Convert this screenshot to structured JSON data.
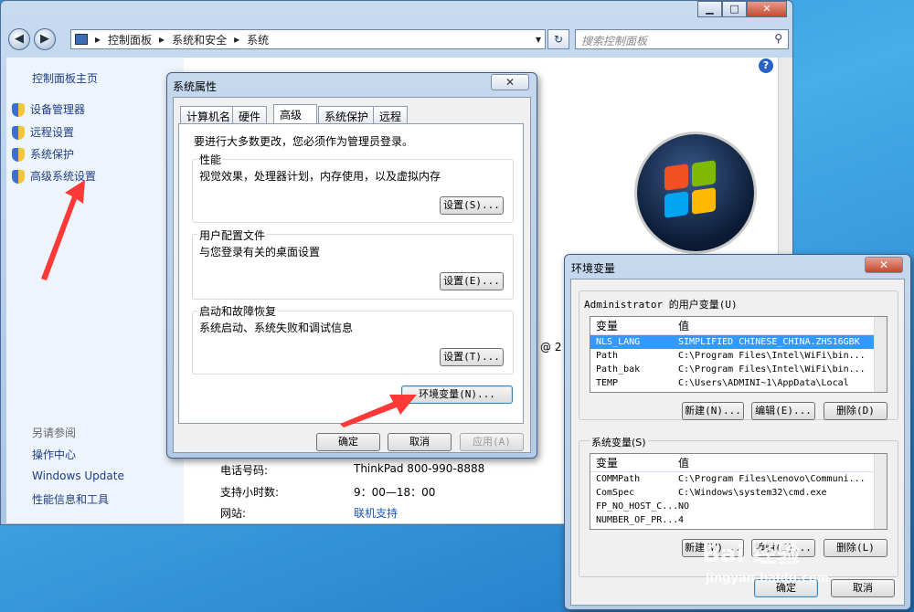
{
  "control_panel": {
    "window_buttons": [
      "▁",
      "□",
      "✕"
    ],
    "breadcrumb": [
      "控制面板",
      "系统和安全",
      "系统"
    ],
    "search_placeholder": "搜索控制面板",
    "help_label": "?",
    "sidebar": {
      "home": "控制面板主页",
      "items": [
        "设备管理器",
        "远程设置",
        "系统保护",
        "高级系统设置"
      ],
      "see_also_title": "另请参阅",
      "see_also": [
        "操作中心",
        "Windows Update",
        "性能信息和工具"
      ]
    },
    "support": [
      {
        "label": "电话号码:",
        "value": "ThinkPad 800-990-8888"
      },
      {
        "label": "支持小时数:",
        "value": "9：00—18：00"
      },
      {
        "label": "网站:",
        "value": "联机支持"
      }
    ],
    "copyright_fragment": "@ 2"
  },
  "system_properties": {
    "title": "系统属性",
    "close_label": "✕",
    "tabs": [
      "计算机名",
      "硬件",
      "高级",
      "系统保护",
      "远程"
    ],
    "active_tab": "高级",
    "admin_note": "要进行大多数更改，您必须作为管理员登录。",
    "groups": [
      {
        "title": "性能",
        "desc": "视觉效果，处理器计划，内存使用，以及虚拟内存",
        "button": "设置(S)..."
      },
      {
        "title": "用户配置文件",
        "desc": "与您登录有关的桌面设置",
        "button": "设置(E)..."
      },
      {
        "title": "启动和故障恢复",
        "desc": "系统启动、系统失败和调试信息",
        "button": "设置(T)..."
      }
    ],
    "env_button": "环境变量(N)...",
    "ok": "确定",
    "cancel": "取消",
    "apply": "应用(A)"
  },
  "env_vars": {
    "title": "环境变量",
    "close_label": "✕",
    "user_section": "Administrator 的用户变量(U)",
    "col_var": "变量",
    "col_val": "值",
    "user_vars": [
      {
        "name": "NLS_LANG",
        "value": "SIMPLIFIED CHINESE_CHINA.ZHS16GBK"
      },
      {
        "name": "Path",
        "value": "C:\\Program Files\\Intel\\WiFi\\bin..."
      },
      {
        "name": "Path_bak",
        "value": "C:\\Program Files\\Intel\\WiFi\\bin..."
      },
      {
        "name": "TEMP",
        "value": "C:\\Users\\ADMINI~1\\AppData\\Local"
      }
    ],
    "user_buttons": [
      "新建(N)...",
      "编辑(E)...",
      "删除(D)"
    ],
    "system_section": "系统变量(S)",
    "system_vars": [
      {
        "name": "COMMPath",
        "value": "C:\\Program Files\\Lenovo\\Communi..."
      },
      {
        "name": "ComSpec",
        "value": "C:\\Windows\\system32\\cmd.exe"
      },
      {
        "name": "FP_NO_HOST_C...",
        "value": "NO"
      },
      {
        "name": "NUMBER_OF_PR...",
        "value": "4"
      }
    ],
    "system_buttons": [
      "新建(W)...",
      "编辑(I)...",
      "删除(L)"
    ],
    "ok": "确定",
    "cancel": "取消"
  },
  "watermark": {
    "logo": "Bai 经验",
    "url": "jingyan.baidu.com"
  }
}
